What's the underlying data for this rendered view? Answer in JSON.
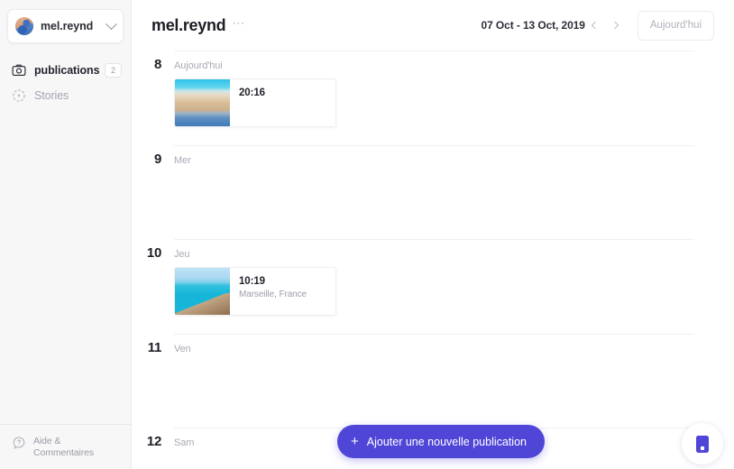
{
  "sidebar": {
    "account": {
      "name": "mel.reynd",
      "avatar_icon": "user-avatar",
      "chevron_icon": "chevron-down-icon"
    },
    "nav": [
      {
        "label": "publications",
        "icon": "camera-icon",
        "badge": "2",
        "active": true
      },
      {
        "label": "Stories",
        "icon": "story-circle-icon",
        "badge": "",
        "active": false
      }
    ],
    "footer": {
      "label": "Aide &\nCommentaires",
      "label_line1": "Aide &",
      "label_line2": "Commentaires",
      "icon": "help-question-icon"
    }
  },
  "header": {
    "title": "mel.reynd",
    "more_icon": "ellipsis-icon",
    "date_range": "07 Oct - 13 Oct, 2019",
    "prev_icon": "chevron-left-icon",
    "next_icon": "chevron-right-icon",
    "today_button": "Aujourd'hui"
  },
  "calendar": {
    "days": [
      {
        "number": "8",
        "name": "Aujourd'hui",
        "posts": [
          {
            "time": "20:16",
            "location": "",
            "thumb": "harbor-boats-photo"
          }
        ]
      },
      {
        "number": "9",
        "name": "Mer",
        "posts": []
      },
      {
        "number": "10",
        "name": "Jeu",
        "posts": [
          {
            "time": "10:19",
            "location": "Marseille, France",
            "thumb": "seaside-corniche-photo"
          }
        ]
      },
      {
        "number": "11",
        "name": "Ven",
        "posts": []
      },
      {
        "number": "12",
        "name": "Sam",
        "posts": []
      }
    ]
  },
  "actions": {
    "add_post_label": "Ajouter une nouvelle publication",
    "add_post_icon": "plus-icon",
    "widget_launcher_icon": "chat-widget-icon"
  },
  "colors": {
    "accent": "#4f46d8",
    "sidebar_bg": "#f7f7f8",
    "text_primary": "#1d1d26",
    "text_muted": "#a9a9b4",
    "divider": "#f0f0f2"
  }
}
